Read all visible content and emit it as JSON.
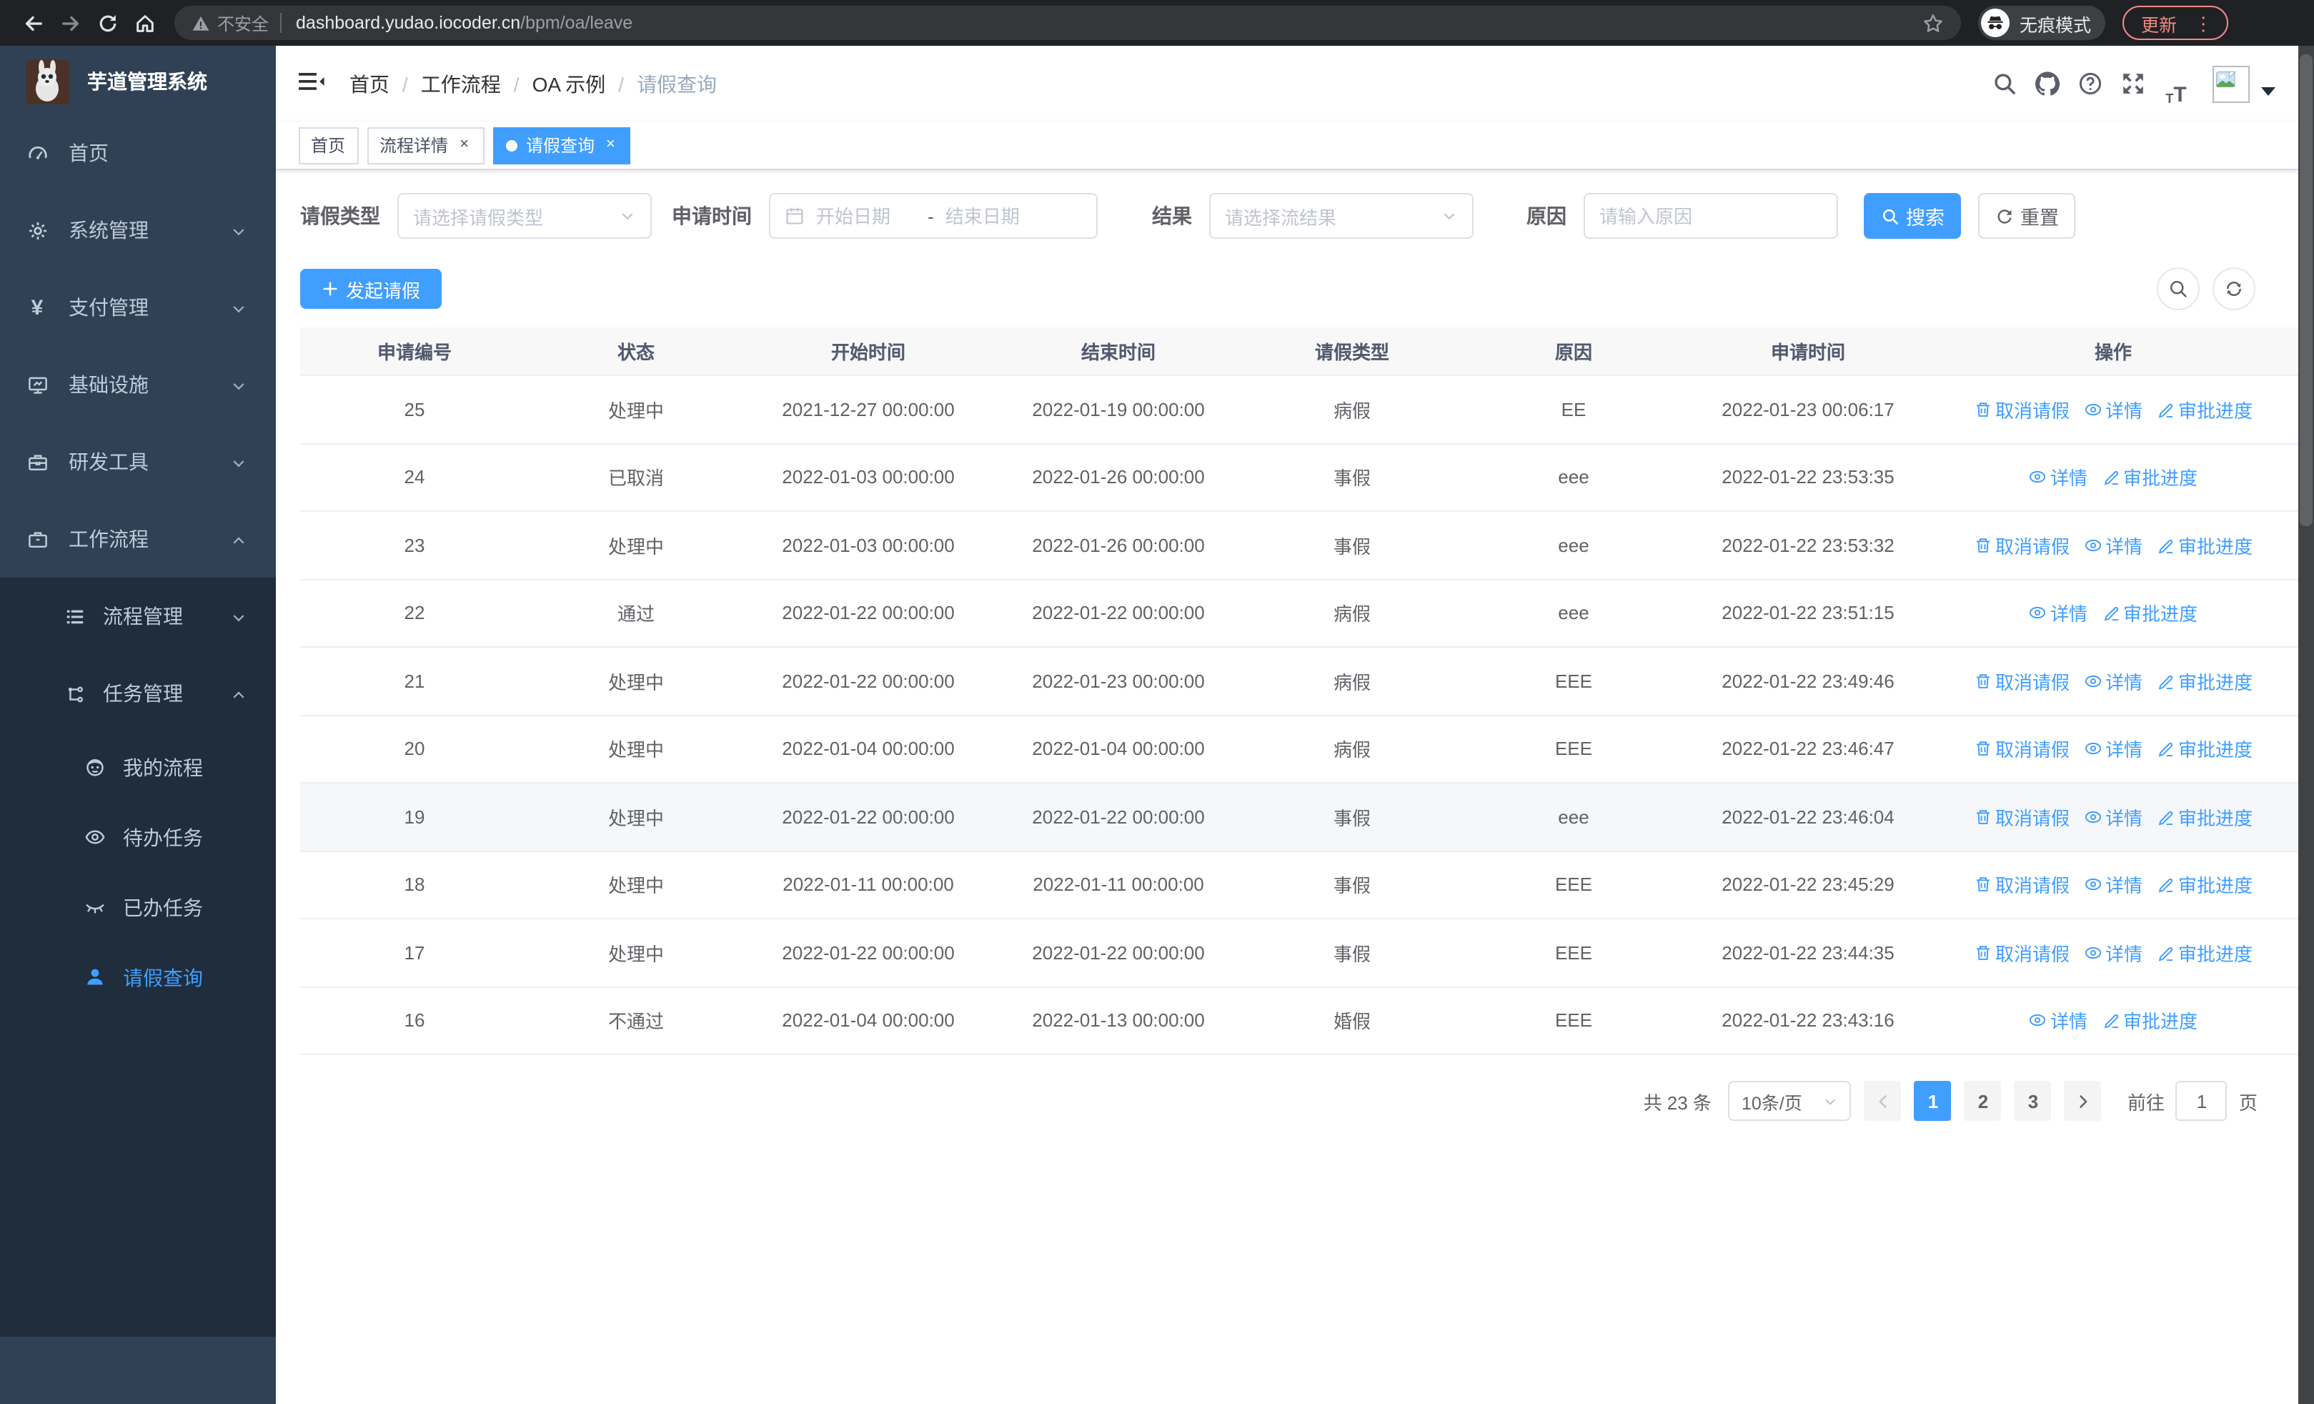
{
  "browser": {
    "security_label": "不安全",
    "url_host": "dashboard.yudao.iocoder.cn",
    "url_path": "/bpm/oa/leave",
    "incognito_label": "无痕模式",
    "update_label": "更新"
  },
  "app": {
    "title": "芋道管理系统",
    "breadcrumb": [
      "首页",
      "工作流程",
      "OA 示例",
      "请假查询"
    ],
    "header_icons": [
      "search-icon",
      "github-icon",
      "help-icon",
      "fullscreen-icon",
      "font-size-icon"
    ]
  },
  "sidebar": {
    "items": [
      {
        "label": "首页",
        "icon": "dashboard-icon",
        "level": 1
      },
      {
        "label": "系统管理",
        "icon": "gear-icon",
        "level": 1,
        "chevron": "down"
      },
      {
        "label": "支付管理",
        "icon": "yen-icon",
        "level": 1,
        "chevron": "down"
      },
      {
        "label": "基础设施",
        "icon": "monitor-icon",
        "level": 1,
        "chevron": "down"
      },
      {
        "label": "研发工具",
        "icon": "toolbox-icon",
        "level": 1,
        "chevron": "down"
      },
      {
        "label": "工作流程",
        "icon": "briefcase-icon",
        "level": 1,
        "chevron": "up"
      },
      {
        "label": "流程管理",
        "icon": "list-icon",
        "level": 2,
        "chevron": "down",
        "in_submenu": true
      },
      {
        "label": "任务管理",
        "icon": "flow-icon",
        "level": 2,
        "chevron": "up",
        "in_submenu": true
      },
      {
        "label": "我的流程",
        "icon": "face-icon",
        "level": 3,
        "in_submenu": true
      },
      {
        "label": "待办任务",
        "icon": "eye-icon",
        "level": 3,
        "in_submenu": true
      },
      {
        "label": "已办任务",
        "icon": "eye-closed-icon",
        "level": 3,
        "in_submenu": true
      },
      {
        "label": "请假查询",
        "icon": "user-icon",
        "level": 3,
        "in_submenu": true,
        "active": true
      }
    ]
  },
  "tabs": [
    {
      "label": "首页",
      "closable": false,
      "active": false
    },
    {
      "label": "流程详情",
      "closable": true,
      "active": false
    },
    {
      "label": "请假查询",
      "closable": true,
      "active": true
    }
  ],
  "filters": {
    "type_label": "请假类型",
    "type_placeholder": "请选择请假类型",
    "time_label": "申请时间",
    "start_placeholder": "开始日期",
    "range_separator": "-",
    "end_placeholder": "结束日期",
    "result_label": "结果",
    "result_placeholder": "请选择流结果",
    "reason_label": "原因",
    "reason_placeholder": "请输入原因",
    "search_label": "搜索",
    "reset_label": "重置"
  },
  "toolbar": {
    "create_label": "发起请假"
  },
  "table": {
    "columns": [
      "申请编号",
      "状态",
      "开始时间",
      "结束时间",
      "请假类型",
      "原因",
      "申请时间",
      "操作"
    ],
    "action_labels": {
      "cancel": "取消请假",
      "detail": "详情",
      "progress": "审批进度"
    },
    "rows": [
      {
        "id": "25",
        "status": "处理中",
        "start": "2021-12-27 00:00:00",
        "end": "2022-01-19 00:00:00",
        "type": "病假",
        "reason": "EE",
        "apply_time": "2022-01-23 00:06:17",
        "actions": [
          "cancel",
          "detail",
          "progress"
        ],
        "hover": false
      },
      {
        "id": "24",
        "status": "已取消",
        "start": "2022-01-03 00:00:00",
        "end": "2022-01-26 00:00:00",
        "type": "事假",
        "reason": "eee",
        "apply_time": "2022-01-22 23:53:35",
        "actions": [
          "detail",
          "progress"
        ],
        "hover": false
      },
      {
        "id": "23",
        "status": "处理中",
        "start": "2022-01-03 00:00:00",
        "end": "2022-01-26 00:00:00",
        "type": "事假",
        "reason": "eee",
        "apply_time": "2022-01-22 23:53:32",
        "actions": [
          "cancel",
          "detail",
          "progress"
        ],
        "hover": false
      },
      {
        "id": "22",
        "status": "通过",
        "start": "2022-01-22 00:00:00",
        "end": "2022-01-22 00:00:00",
        "type": "病假",
        "reason": "eee",
        "apply_time": "2022-01-22 23:51:15",
        "actions": [
          "detail",
          "progress"
        ],
        "hover": false
      },
      {
        "id": "21",
        "status": "处理中",
        "start": "2022-01-22 00:00:00",
        "end": "2022-01-23 00:00:00",
        "type": "病假",
        "reason": "EEE",
        "apply_time": "2022-01-22 23:49:46",
        "actions": [
          "cancel",
          "detail",
          "progress"
        ],
        "hover": false
      },
      {
        "id": "20",
        "status": "处理中",
        "start": "2022-01-04 00:00:00",
        "end": "2022-01-04 00:00:00",
        "type": "病假",
        "reason": "EEE",
        "apply_time": "2022-01-22 23:46:47",
        "actions": [
          "cancel",
          "detail",
          "progress"
        ],
        "hover": false
      },
      {
        "id": "19",
        "status": "处理中",
        "start": "2022-01-22 00:00:00",
        "end": "2022-01-22 00:00:00",
        "type": "事假",
        "reason": "eee",
        "apply_time": "2022-01-22 23:46:04",
        "actions": [
          "cancel",
          "detail",
          "progress"
        ],
        "hover": true
      },
      {
        "id": "18",
        "status": "处理中",
        "start": "2022-01-11 00:00:00",
        "end": "2022-01-11 00:00:00",
        "type": "事假",
        "reason": "EEE",
        "apply_time": "2022-01-22 23:45:29",
        "actions": [
          "cancel",
          "detail",
          "progress"
        ],
        "hover": false
      },
      {
        "id": "17",
        "status": "处理中",
        "start": "2022-01-22 00:00:00",
        "end": "2022-01-22 00:00:00",
        "type": "事假",
        "reason": "EEE",
        "apply_time": "2022-01-22 23:44:35",
        "actions": [
          "cancel",
          "detail",
          "progress"
        ],
        "hover": false
      },
      {
        "id": "16",
        "status": "不通过",
        "start": "2022-01-04 00:00:00",
        "end": "2022-01-13 00:00:00",
        "type": "婚假",
        "reason": "EEE",
        "apply_time": "2022-01-22 23:43:16",
        "actions": [
          "detail",
          "progress"
        ],
        "hover": false
      }
    ]
  },
  "pagination": {
    "total_label": "共 23 条",
    "page_size_label": "10条/页",
    "pages": [
      "1",
      "2",
      "3"
    ],
    "active_page": "1",
    "goto_label": "前往",
    "goto_value": "1",
    "page_unit_label": "页"
  },
  "colors": {
    "accent": "#409eff",
    "chrome_bg": "#202124",
    "sidebar_bg": "#304156",
    "submenu_bg": "#1f2d3d",
    "update_accent": "#f28b82"
  }
}
